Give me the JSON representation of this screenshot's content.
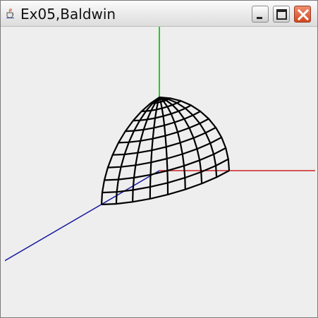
{
  "window": {
    "title": "Ex05,Baldwin",
    "app_icon": "java-cup-icon",
    "controls": {
      "minimize_icon": "minimize-icon",
      "maximize_icon": "maximize-icon",
      "close_icon": "close-icon"
    }
  },
  "scene": {
    "axes": {
      "x_color": "#cc2222",
      "y_color": "#22cc22",
      "z_color": "#1a1aa0"
    },
    "mesh_color": "#000000",
    "shape": "wireframe-quarter-hemisphere"
  }
}
